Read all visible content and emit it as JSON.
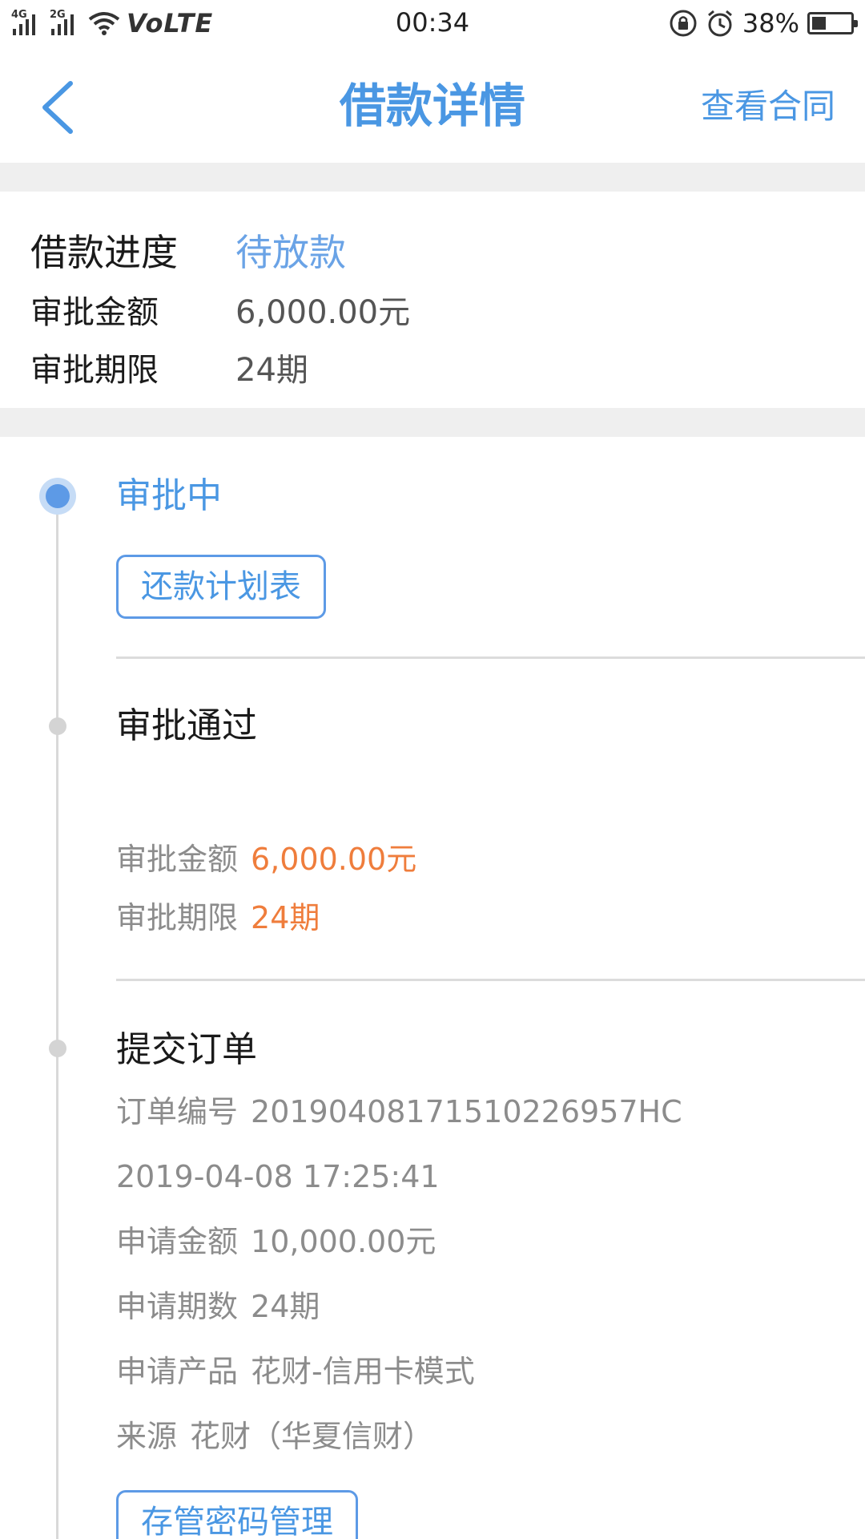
{
  "status_bar": {
    "signal_1": "4G",
    "signal_2": "2G",
    "network": "VoLTE",
    "time": "00:34",
    "battery_percent": "38%",
    "battery_level": 0.38,
    "icons": [
      "signal-4g-icon",
      "signal-2g-icon",
      "wifi-icon",
      "rotation-lock-icon",
      "alarm-icon",
      "battery-icon"
    ]
  },
  "header": {
    "title": "借款详情",
    "right_link": "查看合同",
    "back_icon": "chevron-left-icon"
  },
  "summary": {
    "progress_label": "借款进度",
    "progress_value": "待放款",
    "amount_label": "审批金额",
    "amount_value": "6,000.00元",
    "term_label": "审批期限",
    "term_value": "24期"
  },
  "timeline": {
    "step1": {
      "title": "审批中",
      "button": "还款计划表"
    },
    "step2": {
      "title": "审批通过",
      "amount_label": "审批金额",
      "amount_value": "6,000.00元",
      "term_label": "审批期限",
      "term_value": "24期"
    },
    "step3": {
      "title": "提交订单",
      "order_label": "订单编号",
      "order_value": "20190408171510226957HC",
      "datetime": "2019-04-08 17:25:41",
      "apply_amount_label": "申请金额",
      "apply_amount_value": "10,000.00元",
      "apply_term_label": "申请期数",
      "apply_term_value": "24期",
      "product_label": "申请产品",
      "product_value": "花财-信用卡模式",
      "source_label": "来源",
      "source_value": "花财（华夏信财）",
      "button": "存管密码管理"
    }
  },
  "colors": {
    "accent": "#4a97e3",
    "highlight": "#ef7d3c",
    "muted_text": "#8c8c8c",
    "separator": "#efefef"
  }
}
